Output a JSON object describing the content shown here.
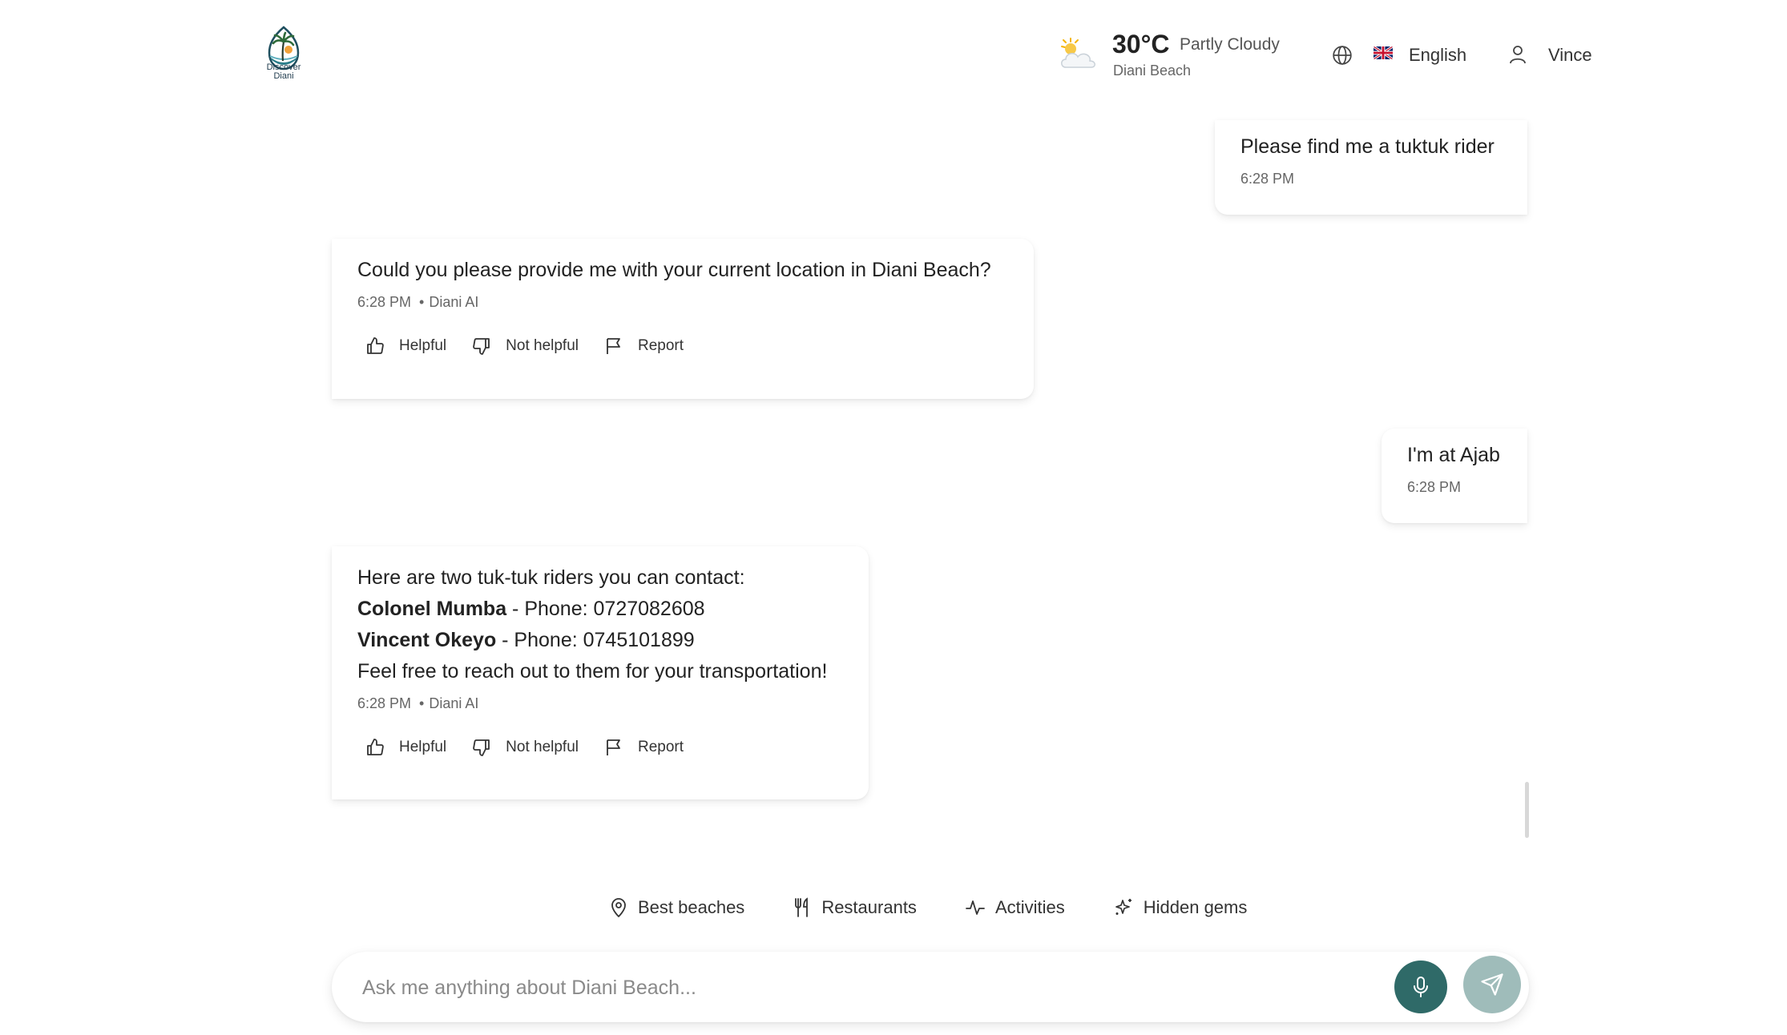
{
  "brand": {
    "logo_line1": "Discover",
    "logo_line2": "Diani"
  },
  "header": {
    "weather": {
      "temperature": "30°C",
      "condition": "Partly Cloudy",
      "location": "Diani Beach",
      "icon": "partly-cloudy-icon"
    },
    "language": {
      "icon": "globe-icon",
      "flag": "uk-flag-icon",
      "label": "English"
    },
    "user": {
      "icon": "user-icon",
      "name": "Vince"
    }
  },
  "messages": [
    {
      "sender": "user",
      "text": "Please find me a tuktuk rider",
      "time": "6:28 PM"
    },
    {
      "sender": "ai",
      "text": "Could you please provide me with your current location in Diani Beach?",
      "time": "6:28 PM",
      "author": "Diani AI"
    },
    {
      "sender": "user",
      "text": "I'm at Ajab",
      "time": "6:28 PM"
    },
    {
      "sender": "ai",
      "intro": "Here are two tuk-tuk riders you can contact:",
      "riders": [
        {
          "name": "Colonel Mumba",
          "detail": " - Phone: 0727082608"
        },
        {
          "name": "Vincent Okeyo",
          "detail": " - Phone: 0745101899"
        }
      ],
      "outro": "Feel free to reach out to them for your transportation!",
      "time": "6:28 PM",
      "author": "Diani AI"
    }
  ],
  "feedback_actions": {
    "helpful": "Helpful",
    "not_helpful": "Not helpful",
    "report": "Report"
  },
  "quick_chips": [
    {
      "label": "Best beaches",
      "icon": "map-pin-icon"
    },
    {
      "label": "Restaurants",
      "icon": "utensils-icon"
    },
    {
      "label": "Activities",
      "icon": "activity-icon"
    },
    {
      "label": "Hidden gems",
      "icon": "sparkles-icon"
    }
  ],
  "input": {
    "placeholder": "Ask me anything about Diani Beach...",
    "value": ""
  },
  "colors": {
    "mic_button": "#2f6a68",
    "send_button": "#9fbcba"
  }
}
